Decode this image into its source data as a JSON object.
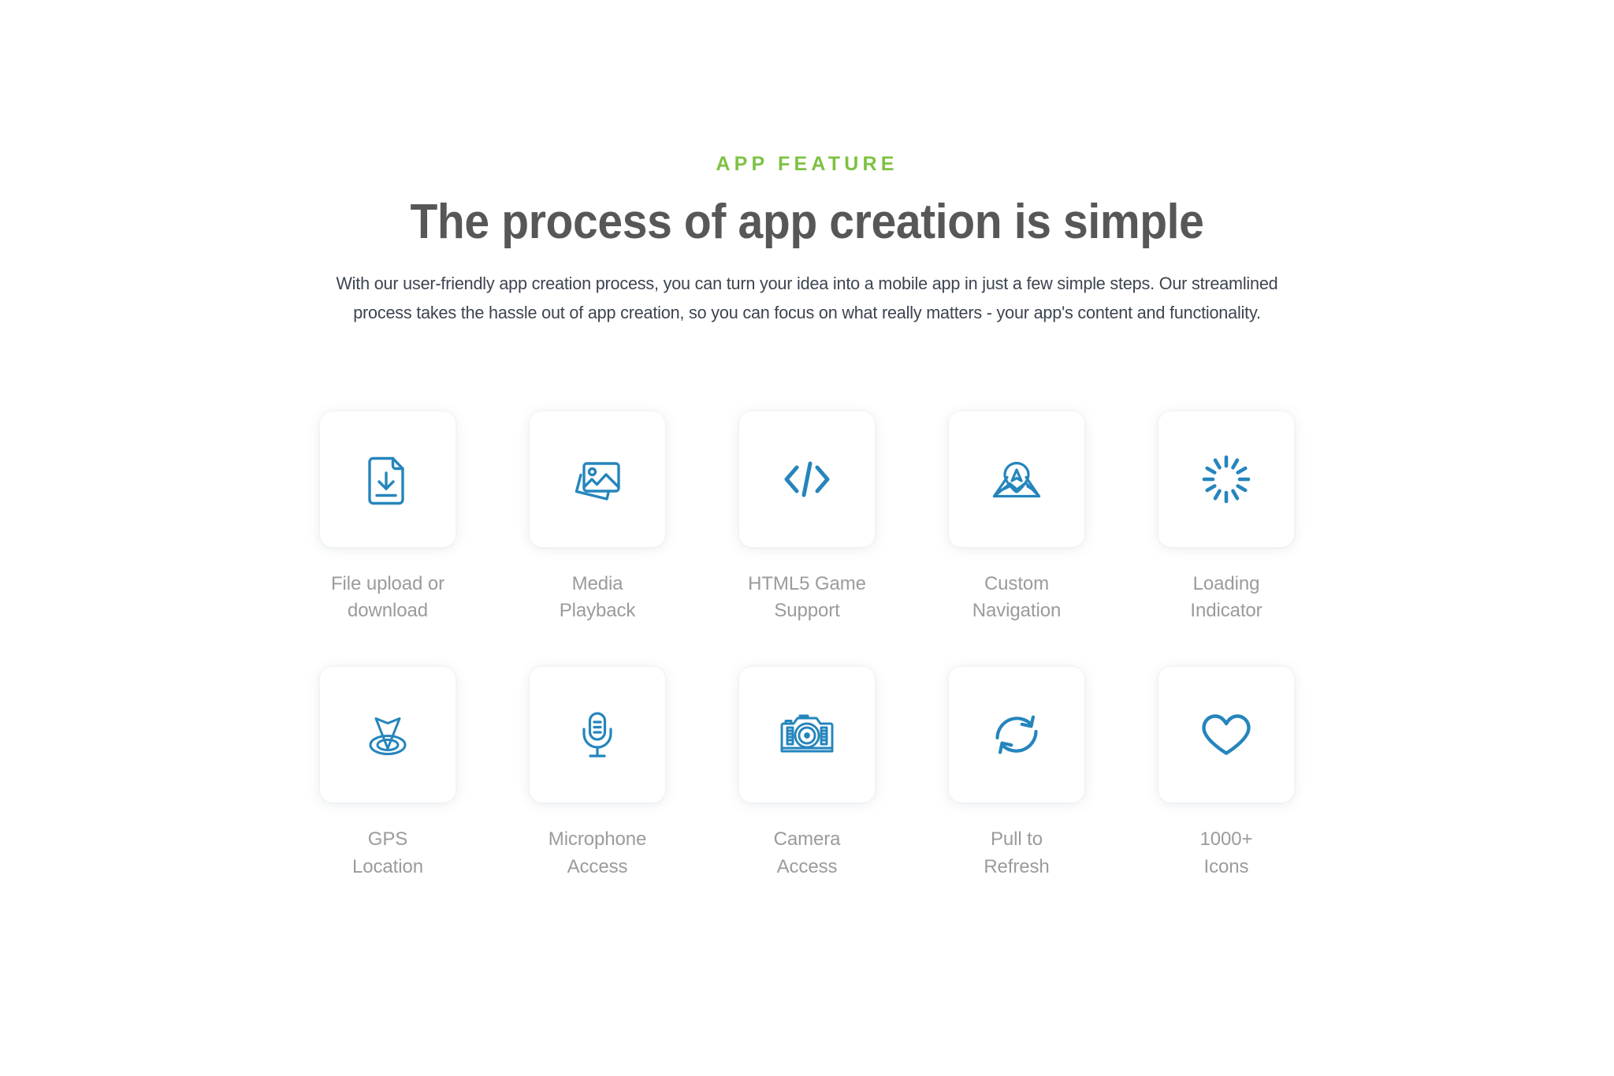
{
  "header": {
    "eyebrow": "APP FEATURE",
    "headline": "The process of app creation is simple",
    "subcopy": "With our user-friendly app creation process, you can turn your idea into a mobile app in just a few simple steps. Our streamlined process takes the hassle out of app creation, so you can focus on what really matters - your app's content and functionality."
  },
  "colors": {
    "accent_green": "#7dc242",
    "icon_blue": "#2585bc",
    "headline_grey": "#575757",
    "label_grey": "#9b9b9b",
    "body_text": "#3c4450",
    "card_background": "#ffffff",
    "page_background": "#ffffff"
  },
  "features": [
    {
      "icon": "file-download-icon",
      "label": "File upload or\ndownload"
    },
    {
      "icon": "media-images-icon",
      "label": "Media\nPlayback"
    },
    {
      "icon": "code-brackets-icon",
      "label": "HTML5 Game\nSupport"
    },
    {
      "icon": "map-navigation-icon",
      "label": "Custom\nNavigation"
    },
    {
      "icon": "loading-spinner-icon",
      "label": "Loading\nIndicator"
    },
    {
      "icon": "gps-location-icon",
      "label": "GPS\nLocation"
    },
    {
      "icon": "microphone-icon",
      "label": "Microphone\nAccess"
    },
    {
      "icon": "camera-icon",
      "label": "Camera\nAccess"
    },
    {
      "icon": "refresh-icon",
      "label": "Pull to\nRefresh"
    },
    {
      "icon": "heart-icon",
      "label": "1000+\nIcons"
    }
  ]
}
